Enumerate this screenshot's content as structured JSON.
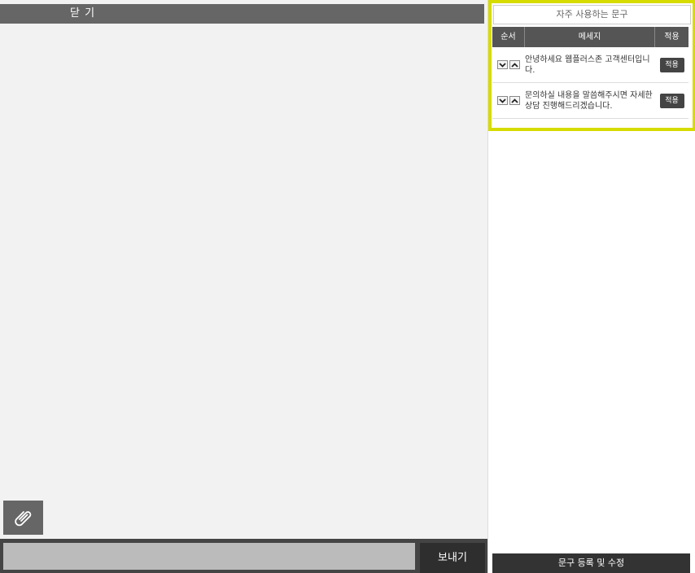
{
  "chat": {
    "close_label": "닫 기",
    "input_value": "",
    "send_label": "보내기",
    "attach_icon": "paperclip-icon"
  },
  "phrases": {
    "title": "자주 사용하는 문구",
    "headers": {
      "order": "순서",
      "message": "메세지",
      "apply": "적용"
    },
    "rows": [
      {
        "message": "안녕하세요 웹플러스존 고객센터입니다.",
        "apply_label": "적용"
      },
      {
        "message": "문의하실 내용을 말씀해주시면 자세한 상담 진행해드리겠습니다.",
        "apply_label": "적용"
      }
    ],
    "register_label": "문구 등록 및 수정"
  },
  "colors": {
    "highlight_border": "#d6db00",
    "header_bg": "#555555",
    "chat_bg": "#f2f2f2"
  }
}
